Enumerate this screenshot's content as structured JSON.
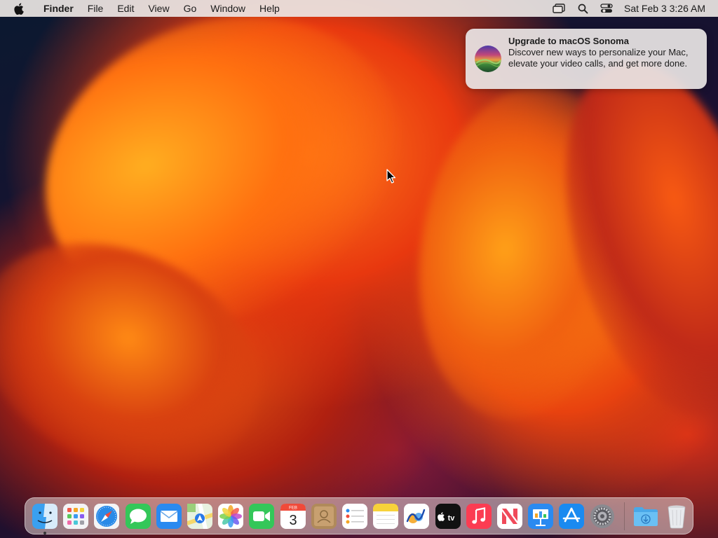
{
  "menubar": {
    "app_name": "Finder",
    "menus": [
      "File",
      "Edit",
      "View",
      "Go",
      "Window",
      "Help"
    ],
    "clock": "Sat Feb 3  3:26 AM",
    "status_icons": [
      "stage-manager-icon",
      "spotlight-search-icon",
      "control-center-icon"
    ]
  },
  "notification": {
    "title": "Upgrade to macOS Sonoma",
    "body": "Discover new ways to personalize your Mac, elevate your video calls, and get more done."
  },
  "dock": {
    "calendar_month": "FEB",
    "calendar_day": "3",
    "apps": [
      "Finder",
      "Launchpad",
      "Safari",
      "Messages",
      "Mail",
      "Maps",
      "Photos",
      "FaceTime",
      "Calendar",
      "Contacts",
      "Reminders",
      "Notes",
      "Freeform",
      "TV",
      "Music",
      "News",
      "Keynote",
      "App Store",
      "System Settings",
      "Downloads",
      "Trash"
    ],
    "tv_label": "tv"
  },
  "colors": {
    "menubar_bg": "#ECE6E4",
    "notification_bg": "#E8E4E4",
    "wallpaper_orange": "#FF7A1A",
    "wallpaper_navy": "#0B1930"
  }
}
